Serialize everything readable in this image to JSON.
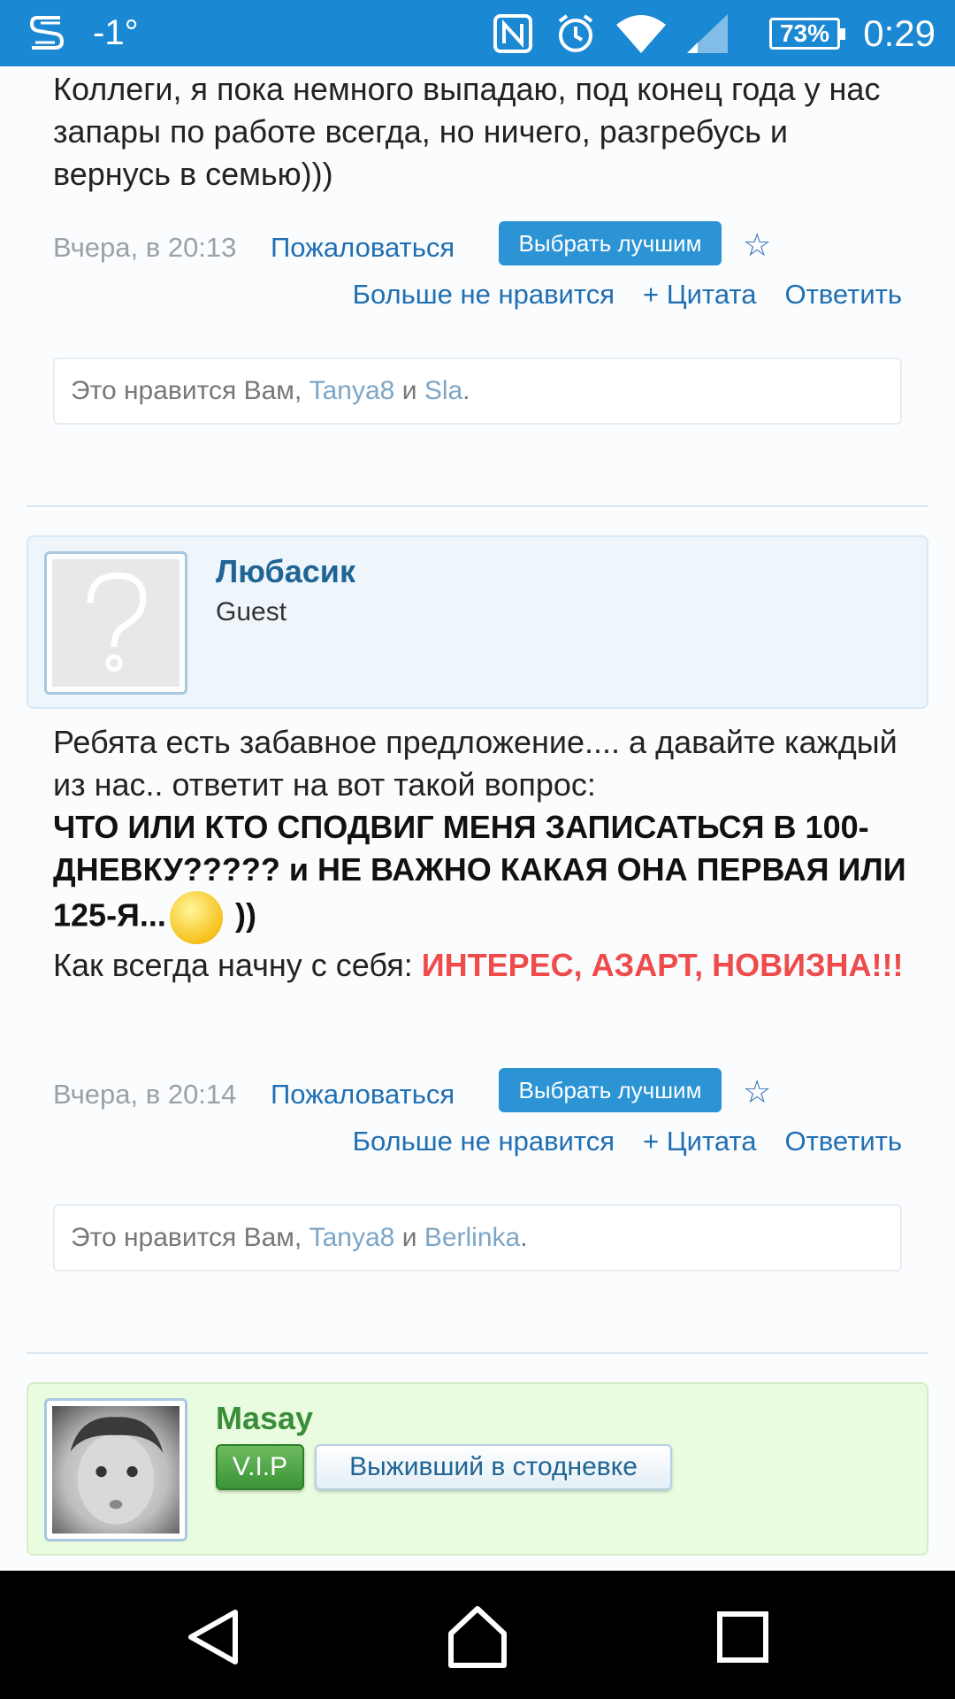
{
  "status_bar": {
    "temperature": "-1°",
    "battery": "73%",
    "time": "0:29",
    "icons": [
      "s-icon",
      "nfc-icon",
      "alarm-icon",
      "wifi-icon",
      "signal-icon",
      "battery-icon"
    ]
  },
  "posts": [
    {
      "text": "Коллеги, я пока немного выпадаю, под конец года у нас запары по работе всегда, но ничего, разгребусь и вернусь в семью)))",
      "date": "Вчера, в 20:13",
      "report": "Пожаловаться",
      "best": "Выбрать лучшим",
      "star": "☆",
      "unlike": "Больше не нравится",
      "quote": "+ Цитата",
      "reply": "Ответить",
      "likes": {
        "prefix": "Это нравится Вам,",
        "user1": "Tanya8",
        "and": "и",
        "user2": "Sla",
        "suffix": "."
      }
    },
    {
      "author": "Любасик",
      "role": "Guest",
      "line1": "Ребята есть забавное предложение.... а давайте каждый из нас.. ответит на вот такой вопрос:",
      "bold": "ЧТО ИЛИ КТО СПОДВИГ МЕНЯ ЗАПИСАТЬСЯ В 100-ДНЕВКУ????? и НЕ ВАЖНО КАКАЯ ОНА ПЕРВАЯ ИЛИ 125-Я...",
      "after_smiley": "))",
      "line3": "Как всегда начну с себя:",
      "highlight": "ИНТЕРЕС, АЗАРТ, НОВИЗНА!!!",
      "date": "Вчера, в 20:14",
      "report": "Пожаловаться",
      "best": "Выбрать лучшим",
      "star": "☆",
      "unlike": "Больше не нравится",
      "quote": "+ Цитата",
      "reply": "Ответить",
      "likes": {
        "prefix": "Это нравится Вам,",
        "user1": "Tanya8",
        "and": "и",
        "user2": "Berlinka",
        "suffix": "."
      }
    },
    {
      "author": "Masay",
      "badge_vip": "V.I.P",
      "badge_title": "Выживший в стодневке"
    }
  ],
  "colors": {
    "status_bar": "#1b88d3",
    "link": "#1f6fb2",
    "button": "#2c93d5",
    "highlight_red": "#ef4b4b",
    "vip_green": "#3a8d3a"
  },
  "nav": {
    "icons": [
      "back-icon",
      "home-icon",
      "recents-icon"
    ]
  }
}
